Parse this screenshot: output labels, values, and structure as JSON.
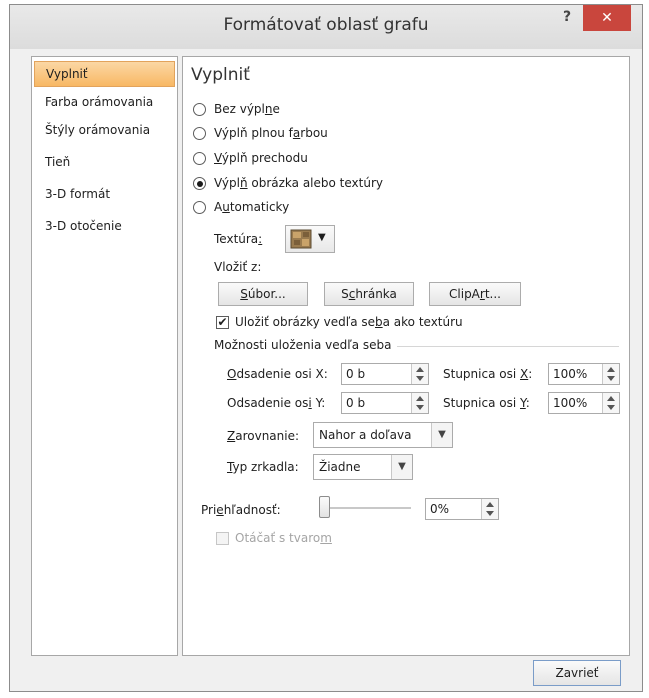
{
  "dialog": {
    "title": "Formátovať oblasť grafu",
    "help_label": "?",
    "close_label": "✕"
  },
  "nav": {
    "items": [
      {
        "label": "Vyplniť",
        "selected": true
      },
      {
        "label": "Farba orámovania"
      },
      {
        "label": "Štýly orámovania"
      },
      {
        "label": "Tieň"
      },
      {
        "label": "3-D formát"
      },
      {
        "label": "3-D otočenie"
      }
    ]
  },
  "panel": {
    "heading": "Vyplniť",
    "radios": [
      {
        "pre": "Bez výpl",
        "key": "n",
        "post": "e",
        "checked": false
      },
      {
        "pre": "Výplň plnou f",
        "key": "a",
        "post": "rbou",
        "checked": false
      },
      {
        "pre": "",
        "key": "V",
        "post": "ýplň prechodu",
        "checked": false
      },
      {
        "pre": "Výpl",
        "key": "ň",
        "post": " obrázka alebo textúry",
        "checked": true
      },
      {
        "pre": "A",
        "key": "u",
        "post": "tomaticky",
        "checked": false
      }
    ],
    "texture": {
      "pre": "Textúra",
      "key": ":",
      "icon": "texture-swatch-icon"
    },
    "insert_from": "Vložiť z:",
    "buttons": {
      "file": {
        "pre": "",
        "key": "S",
        "post": "úbor..."
      },
      "clipboard": {
        "pre": "S",
        "key": "c",
        "post": "hránka"
      },
      "clipart": {
        "pre": "ClipA",
        "key": "r",
        "post": "t..."
      }
    },
    "tile_checkbox": {
      "pre": "Uložiť obrázky vedľa se",
      "key": "b",
      "post": "a ako textúru",
      "checked": true
    },
    "tiling_section": "Možnosti uloženia vedľa seba",
    "offset_x": {
      "pre": "",
      "key": "O",
      "post": "dsadenie osi X:",
      "value": "0 b"
    },
    "offset_y": {
      "pre": "Odsadenie os",
      "key": "i",
      "post": " Y:",
      "value": "0 b"
    },
    "scale_x": {
      "pre": "Stupnica osi ",
      "key": "X",
      "post": ":",
      "value": "100%"
    },
    "scale_y": {
      "pre": "Stupnica osi ",
      "key": "Y",
      "post": ":",
      "value": "100%"
    },
    "alignment": {
      "pre": "",
      "key": "Z",
      "post": "arovnanie:",
      "value": "Nahor a doľava"
    },
    "mirror": {
      "pre": "",
      "key": "T",
      "post": "yp zrkadla:",
      "value": "Žiadne"
    },
    "transparency": {
      "pre": "Pri",
      "key": "e",
      "post": "hľadnosť:",
      "value": "0%",
      "fraction": 0.0
    },
    "rotate_checkbox": {
      "pre": "Otáčať s tvaro",
      "key": "m",
      "post": "",
      "checked": false
    }
  },
  "footer": {
    "close_button": "Zavrieť"
  },
  "colors": {
    "selection_accent": "#f8b864",
    "close_red": "#c9463d"
  }
}
